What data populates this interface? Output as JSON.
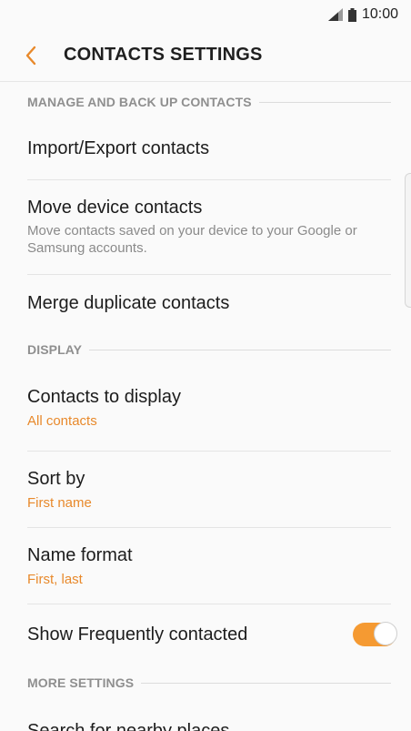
{
  "status_bar": {
    "time": "10:00",
    "icons": [
      "signal-icon",
      "battery-icon"
    ]
  },
  "app_bar": {
    "back_icon": "chevron-left-icon",
    "title": "CONTACTS SETTINGS"
  },
  "sections": {
    "manage": {
      "header": "MANAGE AND BACK UP CONTACTS",
      "import_export": "Import/Export contacts",
      "move_device_title": "Move device contacts",
      "move_device_sub": "Move contacts saved on your device to your Google or Samsung accounts.",
      "merge_duplicates": "Merge duplicate contacts"
    },
    "display": {
      "header": "DISPLAY",
      "contacts_to_display_title": "Contacts to display",
      "contacts_to_display_value": "All contacts",
      "sort_by_title": "Sort by",
      "sort_by_value": "First name",
      "name_format_title": "Name format",
      "name_format_value": "First, last",
      "show_frequent_title": "Show Frequently contacted",
      "show_frequent_on": true
    },
    "more": {
      "header": "MORE SETTINGS",
      "search_nearby": "Search for nearby places"
    }
  },
  "colors": {
    "accent": "#e8892b",
    "toggle_on": "#f59a32",
    "section_header": "#8f8f8f"
  }
}
